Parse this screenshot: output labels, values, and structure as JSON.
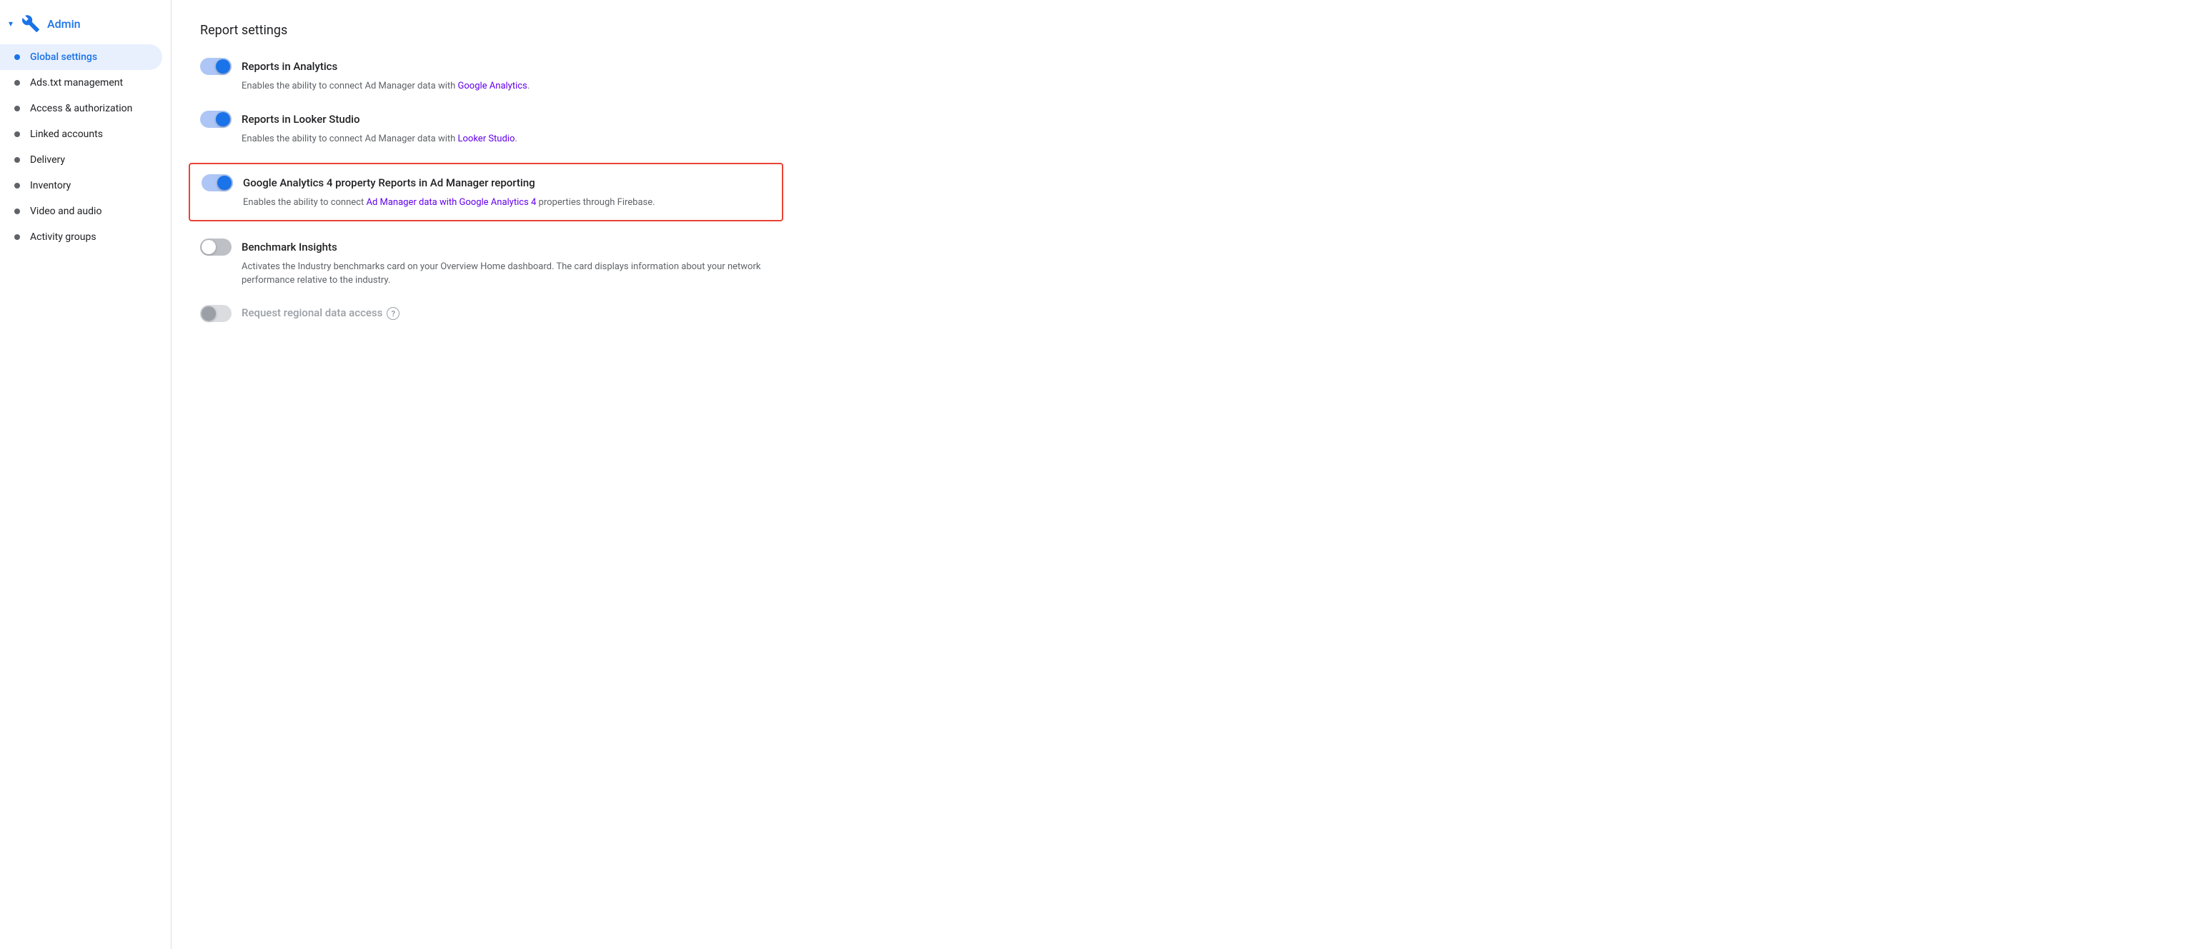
{
  "sidebar": {
    "admin_label": "Admin",
    "items": [
      {
        "id": "global-settings",
        "label": "Global settings",
        "active": true
      },
      {
        "id": "ads-txt",
        "label": "Ads.txt management",
        "active": false
      },
      {
        "id": "access-authorization",
        "label": "Access & authorization",
        "active": false
      },
      {
        "id": "linked-accounts",
        "label": "Linked accounts",
        "active": false
      },
      {
        "id": "delivery",
        "label": "Delivery",
        "active": false
      },
      {
        "id": "inventory",
        "label": "Inventory",
        "active": false
      },
      {
        "id": "video-audio",
        "label": "Video and audio",
        "active": false
      },
      {
        "id": "activity-groups",
        "label": "Activity groups",
        "active": false
      }
    ]
  },
  "main": {
    "section_title": "Report settings",
    "settings": [
      {
        "id": "reports-analytics",
        "title": "Reports in Analytics",
        "description": "Enables the ability to connect Ad Manager data with",
        "link_text": "Google Analytics",
        "description_after": ".",
        "toggle_state": "on",
        "highlighted": false
      },
      {
        "id": "reports-looker",
        "title": "Reports in Looker Studio",
        "description": "Enables the ability to connect Ad Manager data with",
        "link_text": "Looker Studio",
        "description_after": ".",
        "toggle_state": "on",
        "highlighted": false
      },
      {
        "id": "reports-ga4",
        "title": "Google Analytics 4 property Reports in Ad Manager reporting",
        "description": "Enables the ability to connect",
        "link_text": "Ad Manager data with Google Analytics 4",
        "description_after": " properties through Firebase.",
        "toggle_state": "on",
        "highlighted": true
      },
      {
        "id": "benchmark-insights",
        "title": "Benchmark Insights",
        "description": "Activates the Industry benchmarks card on your Overview Home dashboard. The card displays information about your network performance relative to the industry.",
        "link_text": "",
        "description_after": "",
        "toggle_state": "off",
        "highlighted": false
      },
      {
        "id": "regional-data",
        "title": "Request regional data access",
        "description": "",
        "link_text": "",
        "description_after": "",
        "toggle_state": "disabled-off",
        "highlighted": false,
        "has_help": true
      }
    ]
  }
}
